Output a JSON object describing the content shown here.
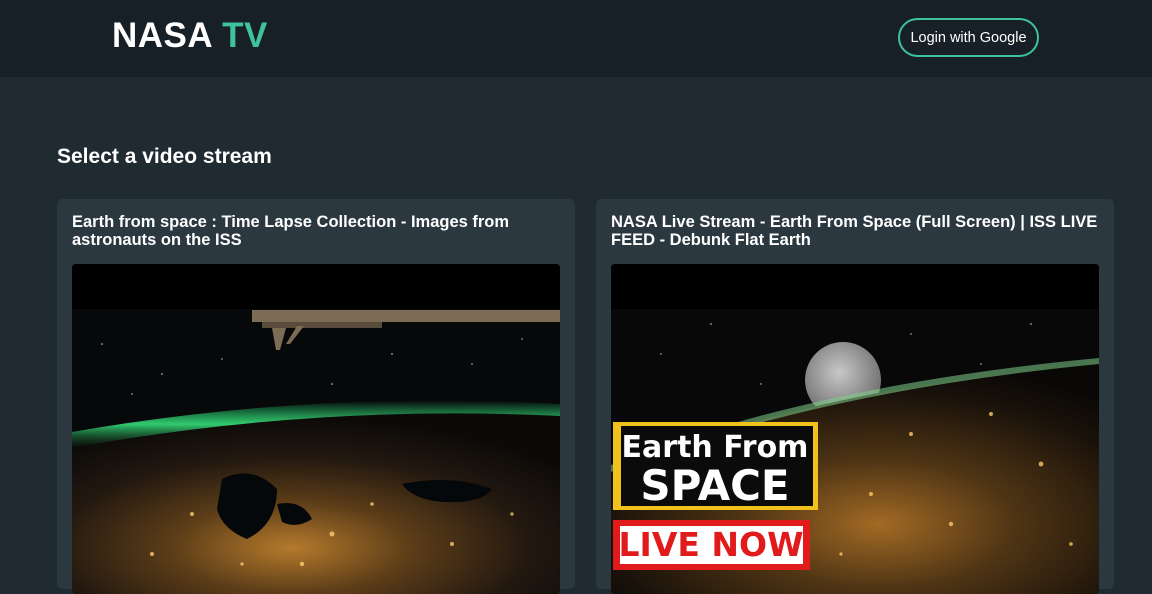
{
  "header": {
    "logo_main": "NASA",
    "logo_accent": "TV",
    "login_label": "Login with Google"
  },
  "main": {
    "title": "Select a video stream",
    "streams": [
      {
        "title": "Earth from space : Time Lapse Collection - Images from astronauts on the ISS"
      },
      {
        "title": "NASA Live Stream - Earth From Space (Full Screen) | ISS LIVE FEED - Debunk Flat Earth",
        "overlay_line1": "Earth From",
        "overlay_line2": "SPACE",
        "overlay_badge": "LIVE NOW"
      }
    ]
  },
  "colors": {
    "accent": "#3ec39a",
    "background": "#1f2a31",
    "header": "#172026",
    "card": "#2b3840"
  }
}
